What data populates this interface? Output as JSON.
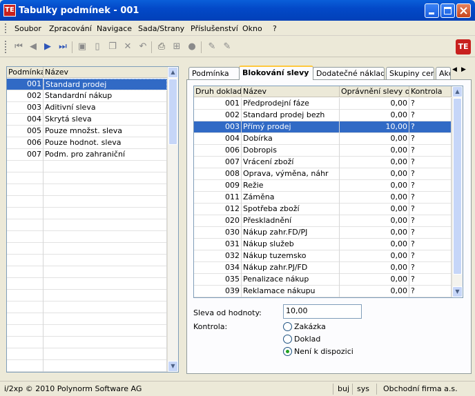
{
  "window": {
    "title": "Tabulky podmínek - 001",
    "icon_text": "TE"
  },
  "menu": [
    "Soubor",
    "Zpracování",
    "Navigace",
    "Sada/Strany",
    "Příslušenství",
    "Okno",
    "?"
  ],
  "toolbar": {
    "icons": [
      "first-icon",
      "prev-icon",
      "next-icon",
      "last-icon",
      "save-icon",
      "new-icon",
      "copy-icon",
      "delete-icon",
      "undo-icon",
      "print-icon",
      "tree-icon",
      "help-icon",
      "edit-icon",
      "edit2-icon"
    ],
    "logo_text": "TE"
  },
  "left_table": {
    "headers": [
      "Podmínka",
      "Název"
    ],
    "rows": [
      {
        "code": "001",
        "name": "Standard prodej"
      },
      {
        "code": "002",
        "name": "Standardní nákup"
      },
      {
        "code": "003",
        "name": "Aditivní sleva"
      },
      {
        "code": "004",
        "name": "Skrytá sleva"
      },
      {
        "code": "005",
        "name": "Pouze množst. sleva"
      },
      {
        "code": "006",
        "name": "Pouze hodnot. sleva"
      },
      {
        "code": "007",
        "name": "Podm. pro zahraniční"
      }
    ],
    "selected_index": 0
  },
  "tabs": [
    "Podmínka",
    "Blokování slevy",
    "Dodatečné náklady",
    "Skupiny cen",
    "Akc"
  ],
  "active_tab": 1,
  "right_table": {
    "headers": [
      "Druh dokladu",
      "Název",
      "Oprávnění slevy od",
      "Kontrola"
    ],
    "rows": [
      {
        "code": "001",
        "name": "Předprodejní fáze",
        "value": "0,00",
        "check": "?"
      },
      {
        "code": "002",
        "name": "Standard prodej bezh",
        "value": "0,00",
        "check": "?"
      },
      {
        "code": "003",
        "name": "Přímý prodej",
        "value": "10,00",
        "check": "?"
      },
      {
        "code": "004",
        "name": "Dobírka",
        "value": "0,00",
        "check": "?"
      },
      {
        "code": "006",
        "name": "Dobropis",
        "value": "0,00",
        "check": "?"
      },
      {
        "code": "007",
        "name": "Vrácení zboží",
        "value": "0,00",
        "check": "?"
      },
      {
        "code": "008",
        "name": "Oprava, výměna, náhr",
        "value": "0,00",
        "check": "?"
      },
      {
        "code": "009",
        "name": "Režie",
        "value": "0,00",
        "check": "?"
      },
      {
        "code": "011",
        "name": "Záměna",
        "value": "0,00",
        "check": "?"
      },
      {
        "code": "012",
        "name": "Spotřeba zboží",
        "value": "0,00",
        "check": "?"
      },
      {
        "code": "020",
        "name": "Přeskladnění",
        "value": "0,00",
        "check": "?"
      },
      {
        "code": "030",
        "name": "Nákup zahr.FD/PJ",
        "value": "0,00",
        "check": "?"
      },
      {
        "code": "031",
        "name": "Nákup služeb",
        "value": "0,00",
        "check": "?"
      },
      {
        "code": "032",
        "name": "Nákup tuzemsko",
        "value": "0,00",
        "check": "?"
      },
      {
        "code": "034",
        "name": "Nákup zahr.PJ/FD",
        "value": "0,00",
        "check": "?"
      },
      {
        "code": "035",
        "name": "Penalizace nákup",
        "value": "0,00",
        "check": "?"
      },
      {
        "code": "039",
        "name": "Reklamace nákupu",
        "value": "0,00",
        "check": "?"
      }
    ],
    "selected_index": 2
  },
  "form": {
    "discount_label": "Sleva od hodnoty:",
    "discount_value": "10,00",
    "control_label": "Kontrola:",
    "radios": [
      {
        "label": "Zakázka",
        "checked": false
      },
      {
        "label": "Doklad",
        "checked": false
      },
      {
        "label": "Není k dispozici",
        "checked": true
      }
    ]
  },
  "status": {
    "copyright": "i/2xp © 2010 Polynorm Software AG",
    "user": "buj",
    "system": "sys",
    "company": "Obchodní firma a.s."
  },
  "colors": {
    "selection": "#316AC5",
    "titlebar": "#0349C8",
    "logo": "#C8201E"
  }
}
